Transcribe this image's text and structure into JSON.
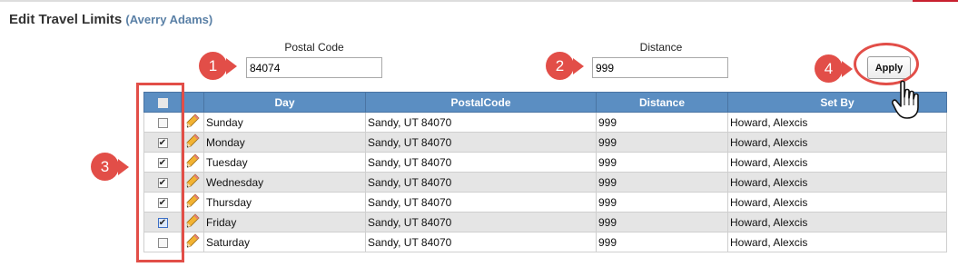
{
  "title": "Edit Travel Limits",
  "subtitle": "(Averry Adams)",
  "form": {
    "postal_code_label": "Postal Code",
    "postal_code_value": "84074",
    "distance_label": "Distance",
    "distance_value": "999",
    "apply_label": "Apply"
  },
  "callouts": [
    "1",
    "2",
    "3",
    "4"
  ],
  "table": {
    "columns": [
      "Day",
      "PostalCode",
      "Distance",
      "Set By"
    ],
    "rows": [
      {
        "checked": false,
        "day": "Sunday",
        "postal": "Sandy, UT 84070",
        "distance": "999",
        "set_by": "Howard, Alexcis"
      },
      {
        "checked": true,
        "day": "Monday",
        "postal": "Sandy, UT 84070",
        "distance": "999",
        "set_by": "Howard, Alexcis"
      },
      {
        "checked": true,
        "day": "Tuesday",
        "postal": "Sandy, UT 84070",
        "distance": "999",
        "set_by": "Howard, Alexcis"
      },
      {
        "checked": true,
        "day": "Wednesday",
        "postal": "Sandy, UT 84070",
        "distance": "999",
        "set_by": "Howard, Alexcis"
      },
      {
        "checked": true,
        "day": "Thursday",
        "postal": "Sandy, UT 84070",
        "distance": "999",
        "set_by": "Howard, Alexcis"
      },
      {
        "checked": true,
        "day": "Friday",
        "postal": "Sandy, UT 84070",
        "distance": "999",
        "set_by": "Howard, Alexcis"
      },
      {
        "checked": false,
        "day": "Saturday",
        "postal": "Sandy, UT 84070",
        "distance": "999",
        "set_by": "Howard, Alexcis"
      }
    ]
  },
  "colors": {
    "header_bg": "#5b8ec2",
    "callout": "#e24e48",
    "subtitle": "#5a80a6",
    "alt_row": "#e5e5e5"
  },
  "icons": [
    "pencil-icon",
    "hand-cursor-icon",
    "checkbox-icon"
  ]
}
